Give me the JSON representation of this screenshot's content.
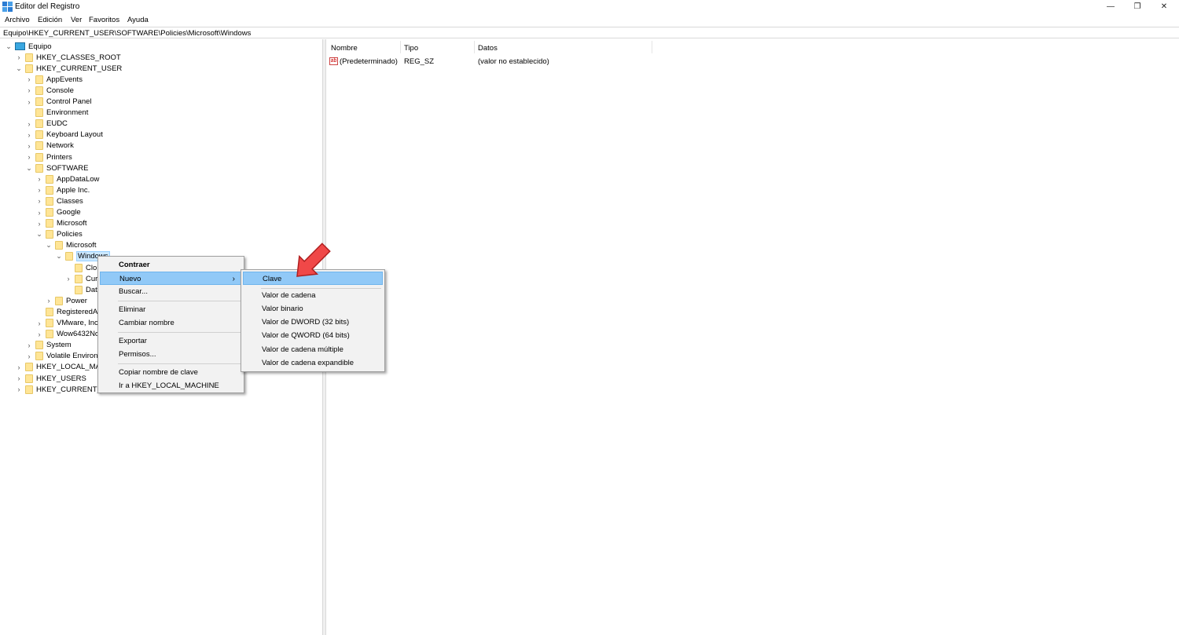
{
  "window": {
    "title": "Editor del Registro",
    "controls": {
      "minimize": "—",
      "restore": "❐",
      "close": "✕"
    }
  },
  "menubar": [
    "Archivo",
    "Edición",
    "Ver",
    "Favoritos",
    "Ayuda"
  ],
  "address": "Equipo\\HKEY_CURRENT_USER\\SOFTWARE\\Policies\\Microsoft\\Windows",
  "tree": {
    "nodes": [
      {
        "label": "Equipo",
        "expander": "v",
        "icon": "computer-icon"
      },
      {
        "label": "HKEY_CLASSES_ROOT",
        "expander": ">"
      },
      {
        "label": "HKEY_CURRENT_USER",
        "expander": "v"
      },
      {
        "label": "AppEvents",
        "expander": ">"
      },
      {
        "label": "Console",
        "expander": ">"
      },
      {
        "label": "Control Panel",
        "expander": ">"
      },
      {
        "label": "Environment",
        "expander": ""
      },
      {
        "label": "EUDC",
        "expander": ">"
      },
      {
        "label": "Keyboard Layout",
        "expander": ">"
      },
      {
        "label": "Network",
        "expander": ">"
      },
      {
        "label": "Printers",
        "expander": ">"
      },
      {
        "label": "SOFTWARE",
        "expander": "v"
      },
      {
        "label": "AppDataLow",
        "expander": ">"
      },
      {
        "label": "Apple Inc.",
        "expander": ">"
      },
      {
        "label": "Classes",
        "expander": ">"
      },
      {
        "label": "Google",
        "expander": ">"
      },
      {
        "label": "Microsoft",
        "expander": ">"
      },
      {
        "label": "Policies",
        "expander": "v"
      },
      {
        "label": "Microsoft",
        "expander": "v"
      },
      {
        "label": "Windows",
        "expander": "v",
        "selected": true
      },
      {
        "label": "Clo",
        "expander": ""
      },
      {
        "label": "Cur",
        "expander": ">"
      },
      {
        "label": "Dat",
        "expander": ""
      },
      {
        "label": "Power",
        "expander": ">"
      },
      {
        "label": "RegisteredAp",
        "expander": ""
      },
      {
        "label": "VMware, Inc.",
        "expander": ">"
      },
      {
        "label": "Wow6432No",
        "expander": ">"
      },
      {
        "label": "System",
        "expander": ">"
      },
      {
        "label": "Volatile Environ",
        "expander": ">"
      },
      {
        "label": "HKEY_LOCAL_MAC",
        "expander": ">"
      },
      {
        "label": "HKEY_USERS",
        "expander": ">"
      },
      {
        "label": "HKEY_CURRENT_C",
        "expander": ">"
      }
    ]
  },
  "list": {
    "columns": [
      "Nombre",
      "Tipo",
      "Datos"
    ],
    "rows": [
      {
        "icon": "ab",
        "name": "(Predeterminado)",
        "type": "REG_SZ",
        "data": "(valor no establecido)"
      }
    ]
  },
  "context_menu": {
    "items": [
      "Contraer",
      "Nuevo",
      "Buscar...",
      "Eliminar",
      "Cambiar nombre",
      "Exportar",
      "Permisos...",
      "Copiar nombre de clave",
      "Ir a HKEY_LOCAL_MACHINE"
    ],
    "submenu_arrow": "›"
  },
  "submenu": {
    "items": [
      "Clave",
      "Valor de cadena",
      "Valor binario",
      "Valor de DWORD (32 bits)",
      "Valor de QWORD (64 bits)",
      "Valor de cadena múltiple",
      "Valor de cadena expandible"
    ]
  },
  "colors": {
    "highlight": "#91c9f7",
    "selection": "#cce8ff",
    "folder": "#ffe596",
    "arrow": "#f04848"
  }
}
